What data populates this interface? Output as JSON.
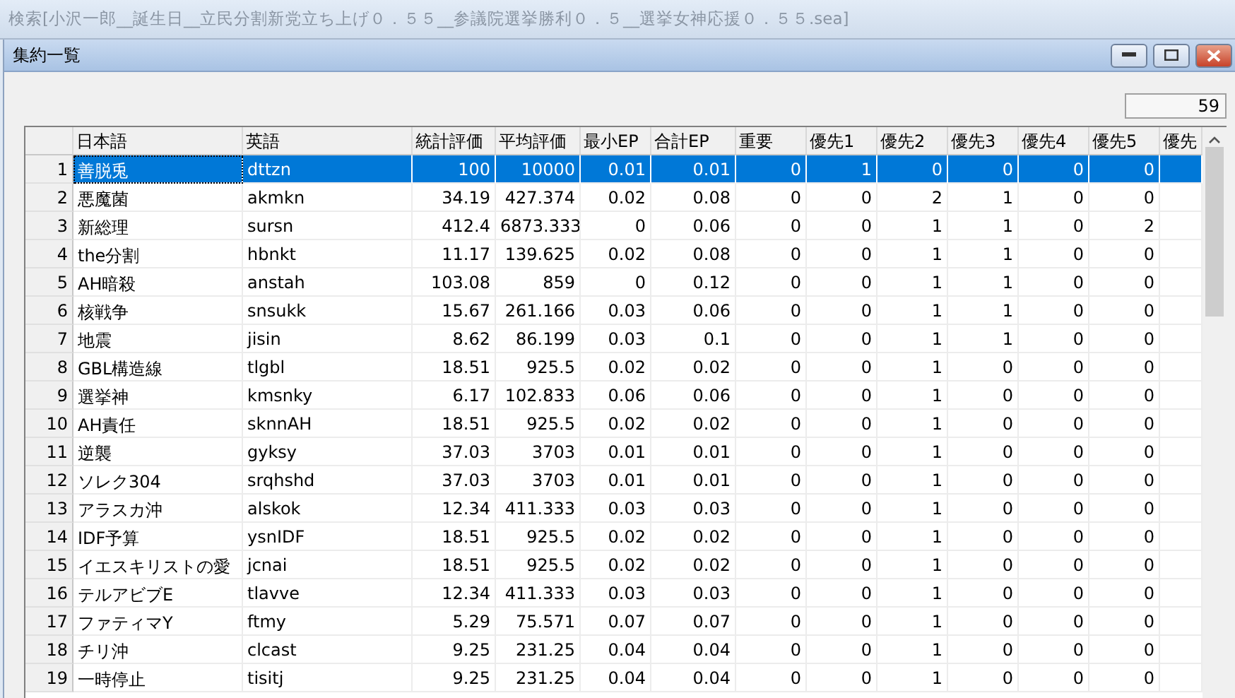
{
  "outer_window": {
    "title": "検索[小沢一郎__誕生日__立民分割新党立ち上げ０．５５__参議院選挙勝利０．５__選挙女神応援０．５５.sea]"
  },
  "window": {
    "title": "集約一覧"
  },
  "count": "59",
  "table": {
    "columns": [
      "日本語",
      "英語",
      "統計評価",
      "平均評価",
      "最小EP",
      "合計EP",
      "重要",
      "優先1",
      "優先2",
      "優先3",
      "優先4",
      "優先5",
      "優先"
    ],
    "rows": [
      {
        "num": "1",
        "selected": true,
        "cells": [
          "善脱兎",
          "dttzn",
          "100",
          "10000",
          "0.01",
          "0.01",
          "0",
          "1",
          "0",
          "0",
          "0",
          "0"
        ]
      },
      {
        "num": "2",
        "selected": false,
        "cells": [
          "悪魔菌",
          "akmkn",
          "34.19",
          "427.374",
          "0.02",
          "0.08",
          "0",
          "0",
          "2",
          "1",
          "0",
          "0"
        ]
      },
      {
        "num": "3",
        "selected": false,
        "cells": [
          "新総理",
          "sursn",
          "412.4",
          "6873.333",
          "0",
          "0.06",
          "0",
          "0",
          "1",
          "1",
          "0",
          "2"
        ]
      },
      {
        "num": "4",
        "selected": false,
        "cells": [
          "the分割",
          "hbnkt",
          "11.17",
          "139.625",
          "0.02",
          "0.08",
          "0",
          "0",
          "1",
          "1",
          "0",
          "0"
        ]
      },
      {
        "num": "5",
        "selected": false,
        "cells": [
          "AH暗殺",
          "anstah",
          "103.08",
          "859",
          "0",
          "0.12",
          "0",
          "0",
          "1",
          "1",
          "0",
          "0"
        ]
      },
      {
        "num": "6",
        "selected": false,
        "cells": [
          "核戦争",
          "snsukk",
          "15.67",
          "261.166",
          "0.03",
          "0.06",
          "0",
          "0",
          "1",
          "1",
          "0",
          "0"
        ]
      },
      {
        "num": "7",
        "selected": false,
        "cells": [
          "地震",
          "jisin",
          "8.62",
          "86.199",
          "0.03",
          "0.1",
          "0",
          "0",
          "1",
          "1",
          "0",
          "0"
        ]
      },
      {
        "num": "8",
        "selected": false,
        "cells": [
          "GBL構造線",
          "tlgbl",
          "18.51",
          "925.5",
          "0.02",
          "0.02",
          "0",
          "0",
          "1",
          "0",
          "0",
          "0"
        ]
      },
      {
        "num": "9",
        "selected": false,
        "cells": [
          "選挙神",
          "kmsnky",
          "6.17",
          "102.833",
          "0.06",
          "0.06",
          "0",
          "0",
          "1",
          "0",
          "0",
          "0"
        ]
      },
      {
        "num": "10",
        "selected": false,
        "cells": [
          "AH責任",
          "sknnAH",
          "18.51",
          "925.5",
          "0.02",
          "0.02",
          "0",
          "0",
          "1",
          "0",
          "0",
          "0"
        ]
      },
      {
        "num": "11",
        "selected": false,
        "cells": [
          "逆襲",
          "gyksy",
          "37.03",
          "3703",
          "0.01",
          "0.01",
          "0",
          "0",
          "1",
          "0",
          "0",
          "0"
        ]
      },
      {
        "num": "12",
        "selected": false,
        "cells": [
          "ソレク304",
          "srqhshd",
          "37.03",
          "3703",
          "0.01",
          "0.01",
          "0",
          "0",
          "1",
          "0",
          "0",
          "0"
        ]
      },
      {
        "num": "13",
        "selected": false,
        "cells": [
          "アラスカ沖",
          "alskok",
          "12.34",
          "411.333",
          "0.03",
          "0.03",
          "0",
          "0",
          "1",
          "0",
          "0",
          "0"
        ]
      },
      {
        "num": "14",
        "selected": false,
        "cells": [
          "IDF予算",
          "ysnIDF",
          "18.51",
          "925.5",
          "0.02",
          "0.02",
          "0",
          "0",
          "1",
          "0",
          "0",
          "0"
        ]
      },
      {
        "num": "15",
        "selected": false,
        "cells": [
          "イエスキリストの愛",
          "jcnai",
          "18.51",
          "925.5",
          "0.02",
          "0.02",
          "0",
          "0",
          "1",
          "0",
          "0",
          "0"
        ]
      },
      {
        "num": "16",
        "selected": false,
        "cells": [
          "テルアビブE",
          "tlavve",
          "12.34",
          "411.333",
          "0.03",
          "0.03",
          "0",
          "0",
          "1",
          "0",
          "0",
          "0"
        ]
      },
      {
        "num": "17",
        "selected": false,
        "cells": [
          "ファティマY",
          "ftmy",
          "5.29",
          "75.571",
          "0.07",
          "0.07",
          "0",
          "0",
          "1",
          "0",
          "0",
          "0"
        ]
      },
      {
        "num": "18",
        "selected": false,
        "cells": [
          "チリ沖",
          "clcast",
          "9.25",
          "231.25",
          "0.04",
          "0.04",
          "0",
          "0",
          "1",
          "0",
          "0",
          "0"
        ]
      },
      {
        "num": "19",
        "selected": false,
        "cells": [
          "一時停止",
          "tisitj",
          "9.25",
          "231.25",
          "0.04",
          "0.04",
          "0",
          "0",
          "1",
          "0",
          "0",
          "0"
        ]
      }
    ]
  }
}
